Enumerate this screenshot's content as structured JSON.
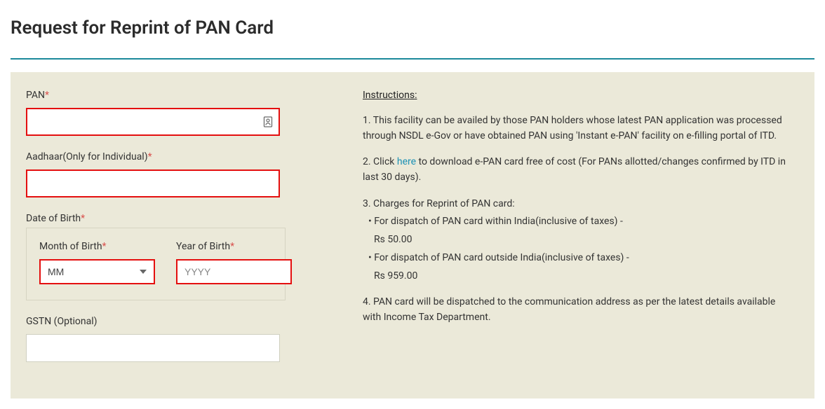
{
  "header": {
    "title": "Request for Reprint of PAN Card"
  },
  "form": {
    "pan": {
      "label": "PAN",
      "required_mark": "*",
      "value": ""
    },
    "aadhaar": {
      "label": "Aadhaar(Only for Individual)",
      "required_mark": "*",
      "value": ""
    },
    "dob": {
      "label": "Date of Birth",
      "required_mark": "*",
      "month": {
        "label": "Month of Birth",
        "required_mark": "*",
        "selected": "MM"
      },
      "year": {
        "label": "Year of Birth",
        "required_mark": "*",
        "placeholder": "YYYY",
        "value": ""
      }
    },
    "gstn": {
      "label": "GSTN (Optional)",
      "value": ""
    }
  },
  "instructions": {
    "heading": "Instructions",
    "p1": "1. This facility can be availed by those PAN holders whose latest PAN application was processed through NSDL e-Gov or have obtained PAN using 'Instant e-PAN' facility on e-filling portal of ITD.",
    "p2_pre": "2. Click ",
    "p2_link": "here",
    "p2_post": " to download e-PAN card free of cost (For PANs allotted/changes confirmed by ITD in last 30 days).",
    "p3": "3. Charges for Reprint of PAN card:",
    "c1_label": "• For dispatch of PAN card within India(inclusive of taxes) -",
    "c1_value": "Rs 50.00",
    "c2_label": "• For dispatch of PAN card outside India(inclusive of taxes) -",
    "c2_value": "Rs 959.00",
    "p4": "4. PAN card will be dispatched to the communication address as per the latest details available with Income Tax Department."
  }
}
